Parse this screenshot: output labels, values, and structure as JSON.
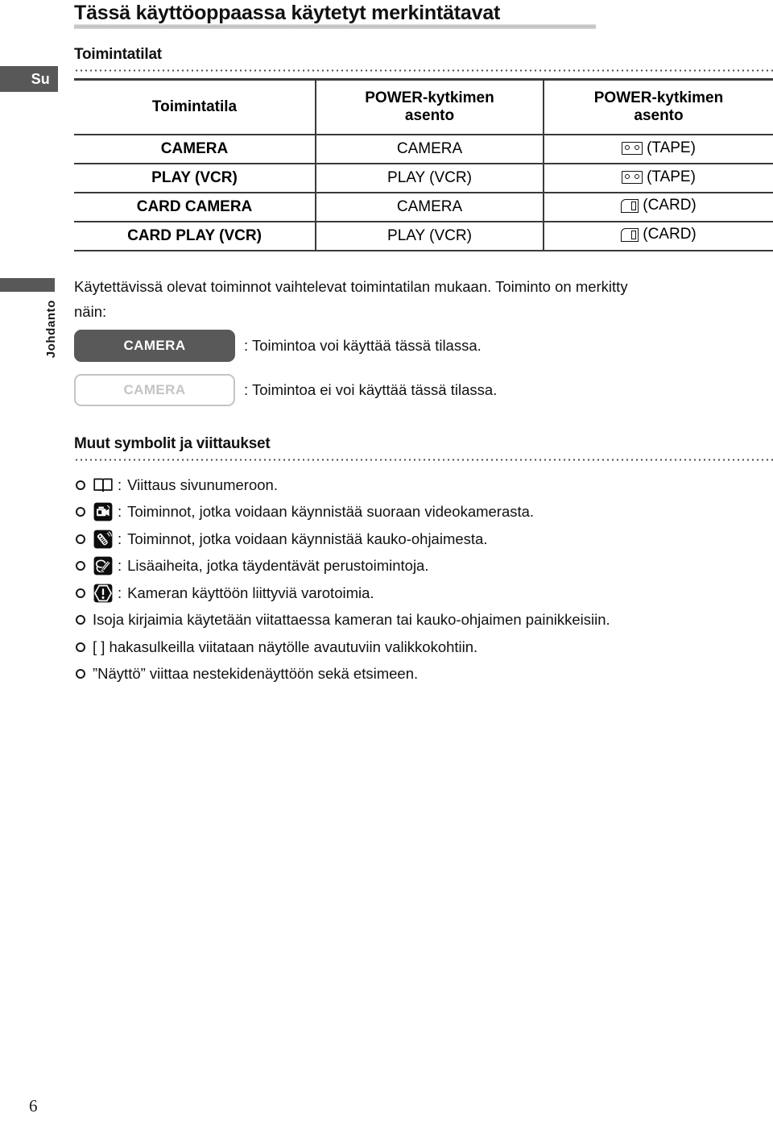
{
  "sidebar": {
    "language_tab": "Su",
    "section_tab": "Johdanto"
  },
  "page": {
    "title": "Tässä käyttöoppaassa käytetyt merkintätavat",
    "folio": "6"
  },
  "modes_section": {
    "heading": "Toimintatilat",
    "table": {
      "headers": [
        "Toimintatila",
        "POWER-kytkimen asento",
        "POWER-kytkimen asento"
      ],
      "header_lines": [
        [
          "Toimintatila"
        ],
        [
          "POWER-kytkimen",
          "asento"
        ],
        [
          "POWER-kytkimen",
          "asento"
        ]
      ],
      "rows": [
        {
          "mode": "CAMERA",
          "switch": "CAMERA",
          "media_icon": "tape-icon",
          "media_label": "(TAPE)"
        },
        {
          "mode": "PLAY (VCR)",
          "switch": "PLAY (VCR)",
          "media_icon": "tape-icon",
          "media_label": "(TAPE)"
        },
        {
          "mode": "CARD CAMERA",
          "switch": "CAMERA",
          "media_icon": "card-icon",
          "media_label": "(CARD)"
        },
        {
          "mode": "CARD PLAY (VCR)",
          "switch": "PLAY (VCR)",
          "media_icon": "card-icon",
          "media_label": "(CARD)"
        }
      ]
    }
  },
  "intro": {
    "paragraph": "Käytettävissä olevat toiminnot vaihtelevat toimintatilan mukaan. Toiminto on merkitty näin:",
    "legend": [
      {
        "chip_label": "CAMERA",
        "state": "available",
        "description": ": Toimintoa voi käyttää tässä tilassa."
      },
      {
        "chip_label": "CAMERA",
        "state": "unavailable",
        "description": ": Toimintoa ei voi käyttää tässä tilassa."
      }
    ]
  },
  "symbols_section": {
    "heading": "Muut symbolit ja viittaukset",
    "items": [
      {
        "icon": "book-icon",
        "colon": ":",
        "text": "Viittaus sivunumeroon."
      },
      {
        "icon": "camcorder-icon",
        "colon": ":",
        "text": "Toiminnot, jotka voidaan käynnistää suoraan videokamerasta."
      },
      {
        "icon": "remote-icon",
        "colon": ":",
        "text": "Toiminnot, jotka voidaan käynnistää kauko-ohjaimesta."
      },
      {
        "icon": "notes-icon",
        "colon": ":",
        "text": "Lisäaiheita, jotka täydentävät perustoimintoja."
      },
      {
        "icon": "warning-icon",
        "colon": ":",
        "text": "Kameran käyttöön liittyviä varotoimia."
      },
      {
        "icon": "none",
        "colon": "",
        "text": "Isoja kirjaimia käytetään viitattaessa kameran tai kauko-ohjaimen painikkeisiin."
      },
      {
        "icon": "none",
        "colon": "",
        "text": "[ ] hakasulkeilla viitataan näytölle avautuviin valikkokohtiin."
      },
      {
        "icon": "none",
        "colon": "",
        "text": "”Näyttö” viittaa nestekidenäyttöön sekä etsimeen."
      }
    ]
  },
  "colors": {
    "tab_gray": "#585858",
    "chip_on_bg": "#595959",
    "chip_off_border": "#c4c4c4",
    "rule_dark": "#3a3a3a",
    "title_rule": "#bdbdbd"
  }
}
